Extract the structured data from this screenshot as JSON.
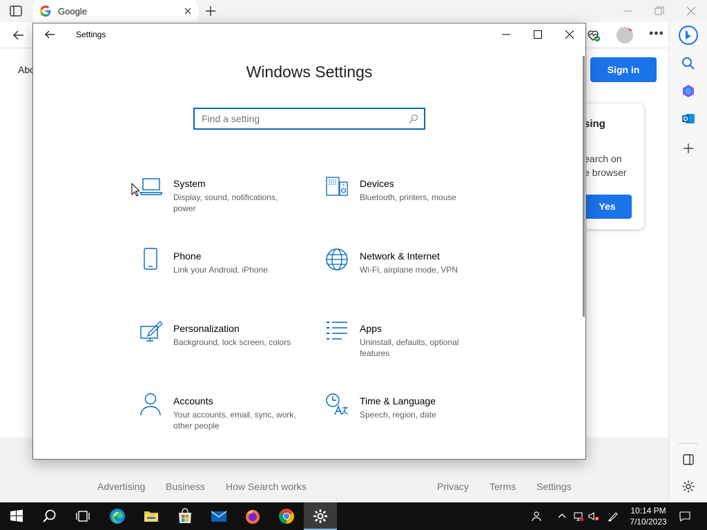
{
  "browser": {
    "tab_title": "Google",
    "page_partial_text": "Abo",
    "sign_in_label": "Sign in",
    "popup": {
      "heading": "sing",
      "line1": "earch on",
      "line2": "e browser",
      "yes_label": "Yes"
    },
    "footer_links": [
      "Advertising",
      "Business",
      "How Search works",
      "Privacy",
      "Terms",
      "Settings"
    ]
  },
  "settings": {
    "window_title": "Settings",
    "heading": "Windows Settings",
    "search": {
      "placeholder": "Find a setting",
      "value": ""
    },
    "categories": [
      {
        "title": "System",
        "desc": "Display, sound, notifications, power",
        "icon": "laptop-icon"
      },
      {
        "title": "Devices",
        "desc": "Bluetooth, printers, mouse",
        "icon": "devices-icon"
      },
      {
        "title": "Phone",
        "desc": "Link your Android, iPhone",
        "icon": "phone-icon"
      },
      {
        "title": "Network & Internet",
        "desc": "Wi-Fi, airplane mode, VPN",
        "icon": "globe-icon"
      },
      {
        "title": "Personalization",
        "desc": "Background, lock screen, colors",
        "icon": "paint-icon"
      },
      {
        "title": "Apps",
        "desc": "Uninstall, defaults, optional features",
        "icon": "apps-list-icon"
      },
      {
        "title": "Accounts",
        "desc": "Your accounts, email, sync, work, other people",
        "icon": "person-icon"
      },
      {
        "title": "Time & Language",
        "desc": "Speech, region, date",
        "icon": "time-language-icon"
      }
    ]
  },
  "taskbar": {
    "time": "10:14 PM",
    "date": "7/10/2023"
  },
  "colors": {
    "accent": "#0067c0",
    "google_blue": "#1a73e8",
    "taskbar": "#101010"
  }
}
